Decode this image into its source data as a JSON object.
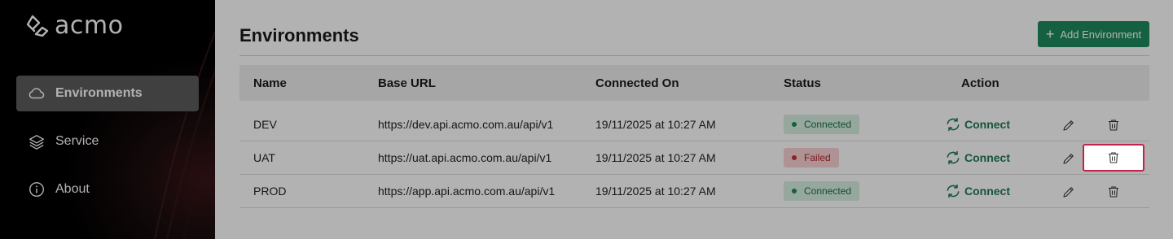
{
  "brand": {
    "name": "acmo"
  },
  "sidebar": {
    "items": [
      {
        "label": "Environments",
        "icon": "cloud-icon",
        "active": true
      },
      {
        "label": "Service",
        "icon": "layers-icon",
        "active": false
      },
      {
        "label": "About",
        "icon": "info-icon",
        "active": false
      }
    ]
  },
  "header": {
    "title": "Environments",
    "add_button_label": "Add Environment"
  },
  "table": {
    "columns": [
      "Name",
      "Base URL",
      "Connected On",
      "Status",
      "Action"
    ],
    "rows": [
      {
        "name": "DEV",
        "base_url": "https://dev.api.acmo.com.au/api/v1",
        "connected_on": "19/11/2025 at 10:27 AM",
        "status": "Connected",
        "action": "Connect"
      },
      {
        "name": "UAT",
        "base_url": "https://uat.api.acmo.com.au/api/v1",
        "connected_on": "19/11/2025 at 10:27 AM",
        "status": "Failed",
        "action": "Connect"
      },
      {
        "name": "PROD",
        "base_url": "https://app.api.acmo.com.au/api/v1",
        "connected_on": "19/11/2025 at 10:27 AM",
        "status": "Connected",
        "action": "Connect"
      }
    ]
  },
  "colors": {
    "accent": "#1f8a5c",
    "connected_bg": "#d7f0e3",
    "failed_bg": "#fbd2d4",
    "highlight_border": "#c0244a"
  }
}
